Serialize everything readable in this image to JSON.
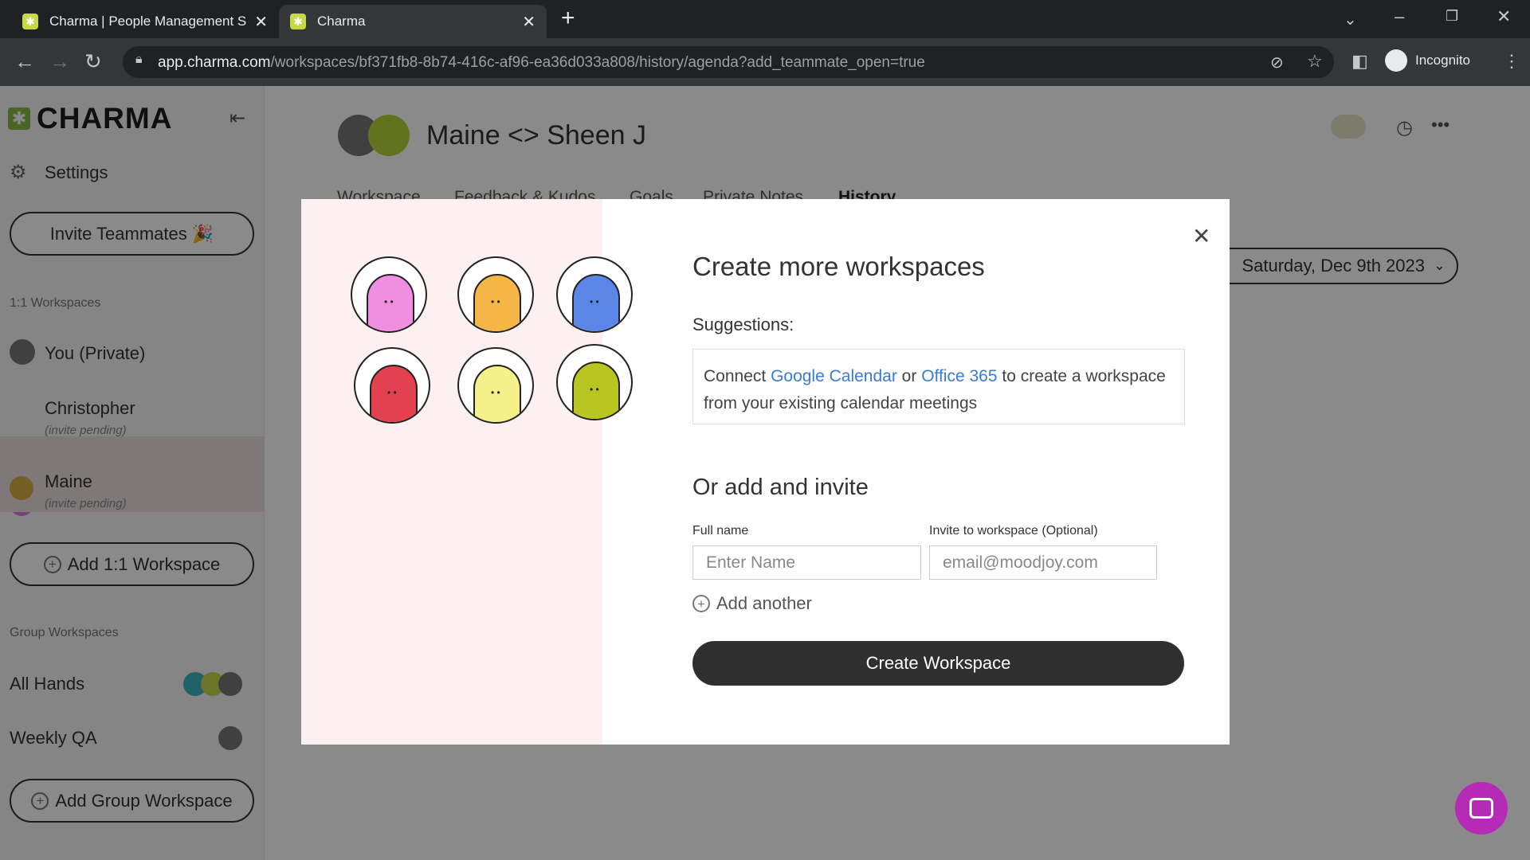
{
  "browser": {
    "tabs": [
      {
        "title": "Charma | People Management S",
        "close": "✕"
      },
      {
        "title": "Charma",
        "close": "✕"
      }
    ],
    "new_tab": "+",
    "url_host": "app.charma.com",
    "url_path": "/workspaces/bf371fb8-8b74-416c-af96-ea36d033a808/history/agenda?add_teammate_open=true",
    "incognito_label": "Incognito"
  },
  "sidebar": {
    "logo_text": "CHARMA",
    "settings_label": "Settings",
    "invite_label": "Invite Teammates 🎉",
    "one_on_one_header": "1:1 Workspaces",
    "one_on_one_items": [
      {
        "name": "You (Private)",
        "sub": ""
      },
      {
        "name": "Christopher",
        "sub": "(invite pending)"
      },
      {
        "name": "Maine",
        "sub": "(invite pending)"
      }
    ],
    "add_one_on_one_label": "Add 1:1 Workspace",
    "group_header": "Group Workspaces",
    "group_items": [
      {
        "name": "All Hands"
      },
      {
        "name": "Weekly QA"
      }
    ],
    "add_group_label": "Add Group Workspace"
  },
  "main": {
    "title": "Maine <> Sheen J",
    "tabs": [
      "Workspace",
      "Feedback & Kudos",
      "Goals",
      "Private Notes",
      "History"
    ],
    "date_label": "Saturday, Dec 9th 2023"
  },
  "modal": {
    "title": "Create more workspaces",
    "suggestions_label": "Suggestions:",
    "suggestion": {
      "prefix": "Connect ",
      "link1": "Google Calendar",
      "mid": " or ",
      "link2": "Office 365",
      "suffix": " to create a workspace from your existing calendar meetings"
    },
    "invite_title": "Or add and invite",
    "full_name_label": "Full name",
    "full_name_placeholder": "Enter Name",
    "email_label": "Invite to workspace (Optional)",
    "email_placeholder": "email@moodjoy.com",
    "add_another_label": "Add another",
    "create_button_label": "Create Workspace",
    "close_glyph": "✕"
  },
  "colors": {
    "blobs": [
      "#f08fe2",
      "#f5b648",
      "#5b86e8",
      "#e2414f",
      "#f4f08a",
      "#b9c520"
    ]
  }
}
